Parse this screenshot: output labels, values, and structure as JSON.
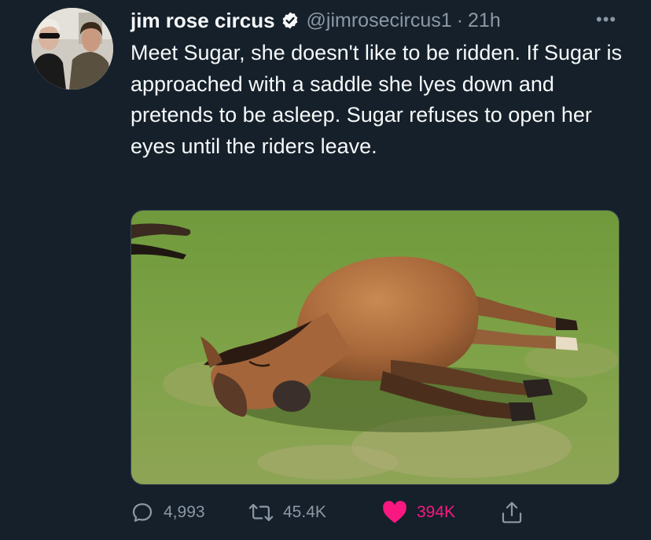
{
  "tweet": {
    "display_name": "jim rose circus",
    "handle": "@jimrosecircus1",
    "separator": "·",
    "timestamp": "21h",
    "more_label": "•••",
    "text": "Meet Sugar, she doesn't like to be ridden. If Sugar is approached with a saddle she lyes down and pretends to be asleep. Sugar refuses to open her eyes until the riders leave."
  },
  "actions": {
    "reply_count": "4,993",
    "retweet_count": "45.4K",
    "like_count": "394K"
  },
  "icons": {
    "reply": "reply-icon",
    "retweet": "retweet-icon",
    "like": "heart-icon",
    "share": "share-icon",
    "verified": "verified-badge-icon",
    "more": "more-options-icon"
  },
  "colors": {
    "background": "#15202b",
    "text": "#f7f9f9",
    "muted": "#8b98a5",
    "like": "#f91880"
  }
}
